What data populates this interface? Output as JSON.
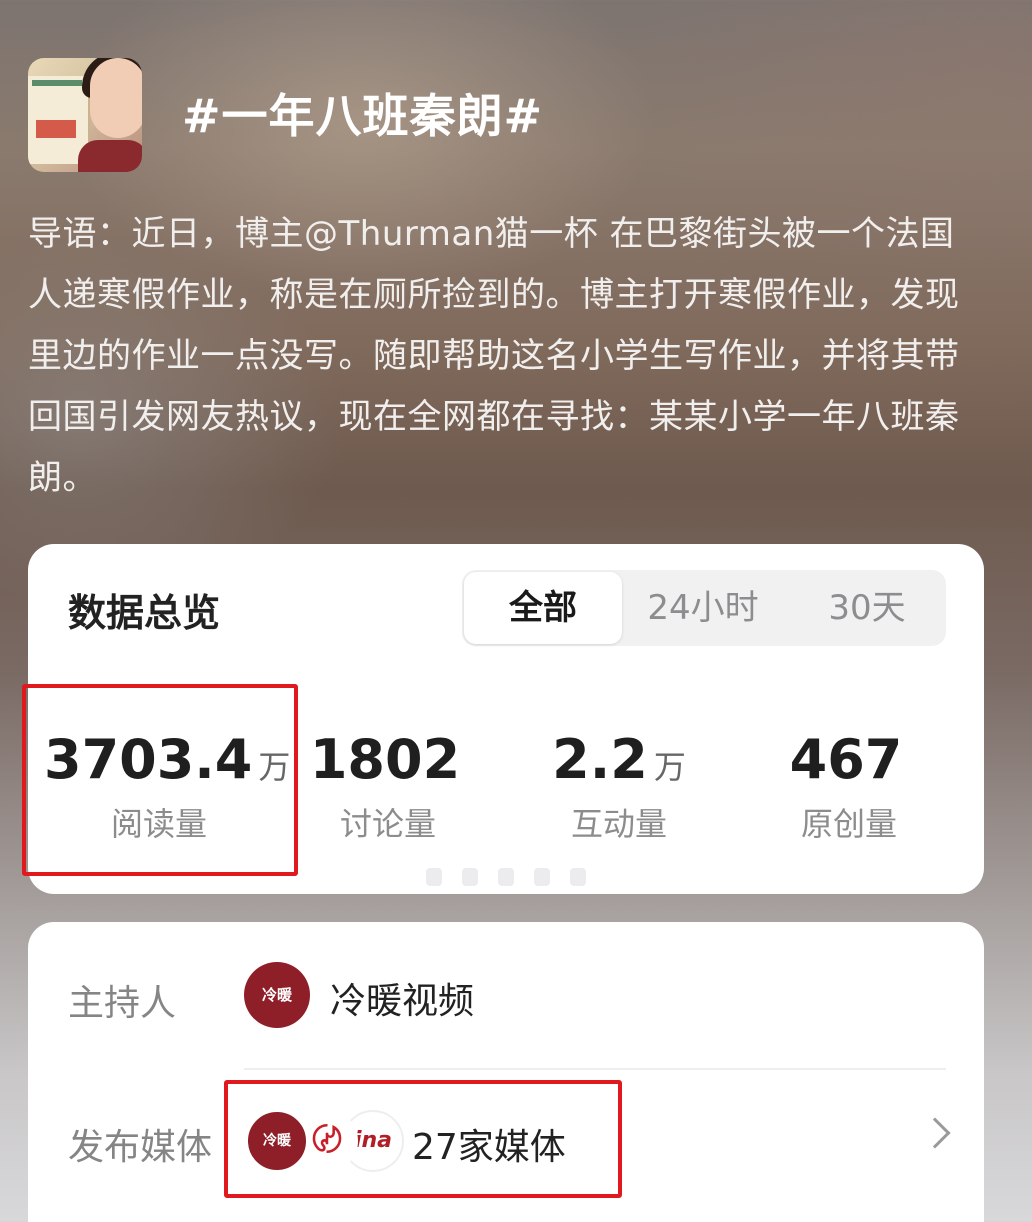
{
  "header": {
    "title": "#一年八班秦朗#"
  },
  "intro": {
    "text": "导语：近日，博主@Thurman猫一杯 在巴黎街头被一个法国人递寒假作业，称是在厕所捡到的。博主打开寒假作业，发现里边的作业一点没写。随即帮助这名小学生写作业，并将其带回国引发网友热议，现在全网都在寻找：某某小学一年八班秦朗。"
  },
  "overview": {
    "title": "数据总览",
    "tabs": [
      {
        "label": "全部",
        "active": true
      },
      {
        "label": "24小时",
        "active": false
      },
      {
        "label": "30天",
        "active": false
      }
    ],
    "stats": [
      {
        "value": "3703.4",
        "unit": "万",
        "label": "阅读量"
      },
      {
        "value": "1802",
        "unit": "",
        "label": "讨论量"
      },
      {
        "value": "2.2",
        "unit": "万",
        "label": "互动量"
      },
      {
        "value": "467",
        "unit": "",
        "label": "原创量"
      }
    ]
  },
  "info": {
    "host_label": "主持人",
    "host_avatar_text": "冷暖",
    "host_name": "冷暖视频",
    "media_label": "发布媒体",
    "media_avatars": [
      "冷暖",
      "〄",
      "ina"
    ],
    "media_count_text": "27家媒体"
  },
  "colors": {
    "highlight": "#e0191e",
    "brand_red": "#8e1e28"
  }
}
